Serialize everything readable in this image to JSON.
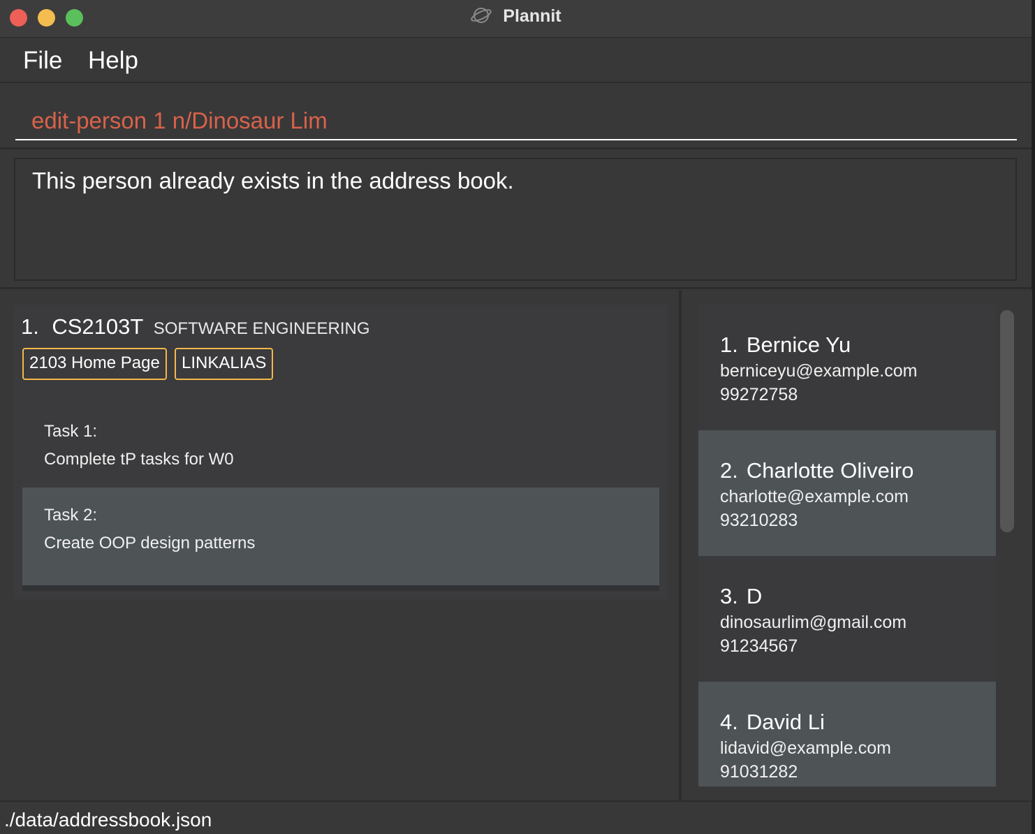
{
  "window": {
    "title": "Plannit"
  },
  "menu": {
    "items": [
      "File",
      "Help"
    ]
  },
  "command": {
    "value": "edit-person 1 n/Dinosaur Lim"
  },
  "result": {
    "message": "This person already exists in the address book."
  },
  "module": {
    "index": "1.",
    "code": "CS2103T",
    "name": "SOFTWARE ENGINEERING",
    "tags": [
      "2103 Home Page",
      "LINKALIAS"
    ],
    "tasks": [
      {
        "label": "Task 1:",
        "description": "Complete tP tasks for W0"
      },
      {
        "label": "Task 2:",
        "description": "Create OOP design patterns"
      }
    ]
  },
  "persons": [
    {
      "index": "1.",
      "name": "Bernice Yu",
      "email": "berniceyu@example.com",
      "phone": "99272758"
    },
    {
      "index": "2.",
      "name": "Charlotte Oliveiro",
      "email": "charlotte@example.com",
      "phone": "93210283"
    },
    {
      "index": "3.",
      "name": "D",
      "email": "dinosaurlim@gmail.com",
      "phone": "91234567"
    },
    {
      "index": "4.",
      "name": "David Li",
      "email": "lidavid@example.com",
      "phone": "91031282"
    }
  ],
  "status": {
    "path": "./data/addressbook.json"
  },
  "colors": {
    "accent_command_text": "#d9624b",
    "tag_border": "#f3b94a",
    "selected_row": "#4e5356"
  },
  "icons": {
    "title": "planet-icon"
  }
}
